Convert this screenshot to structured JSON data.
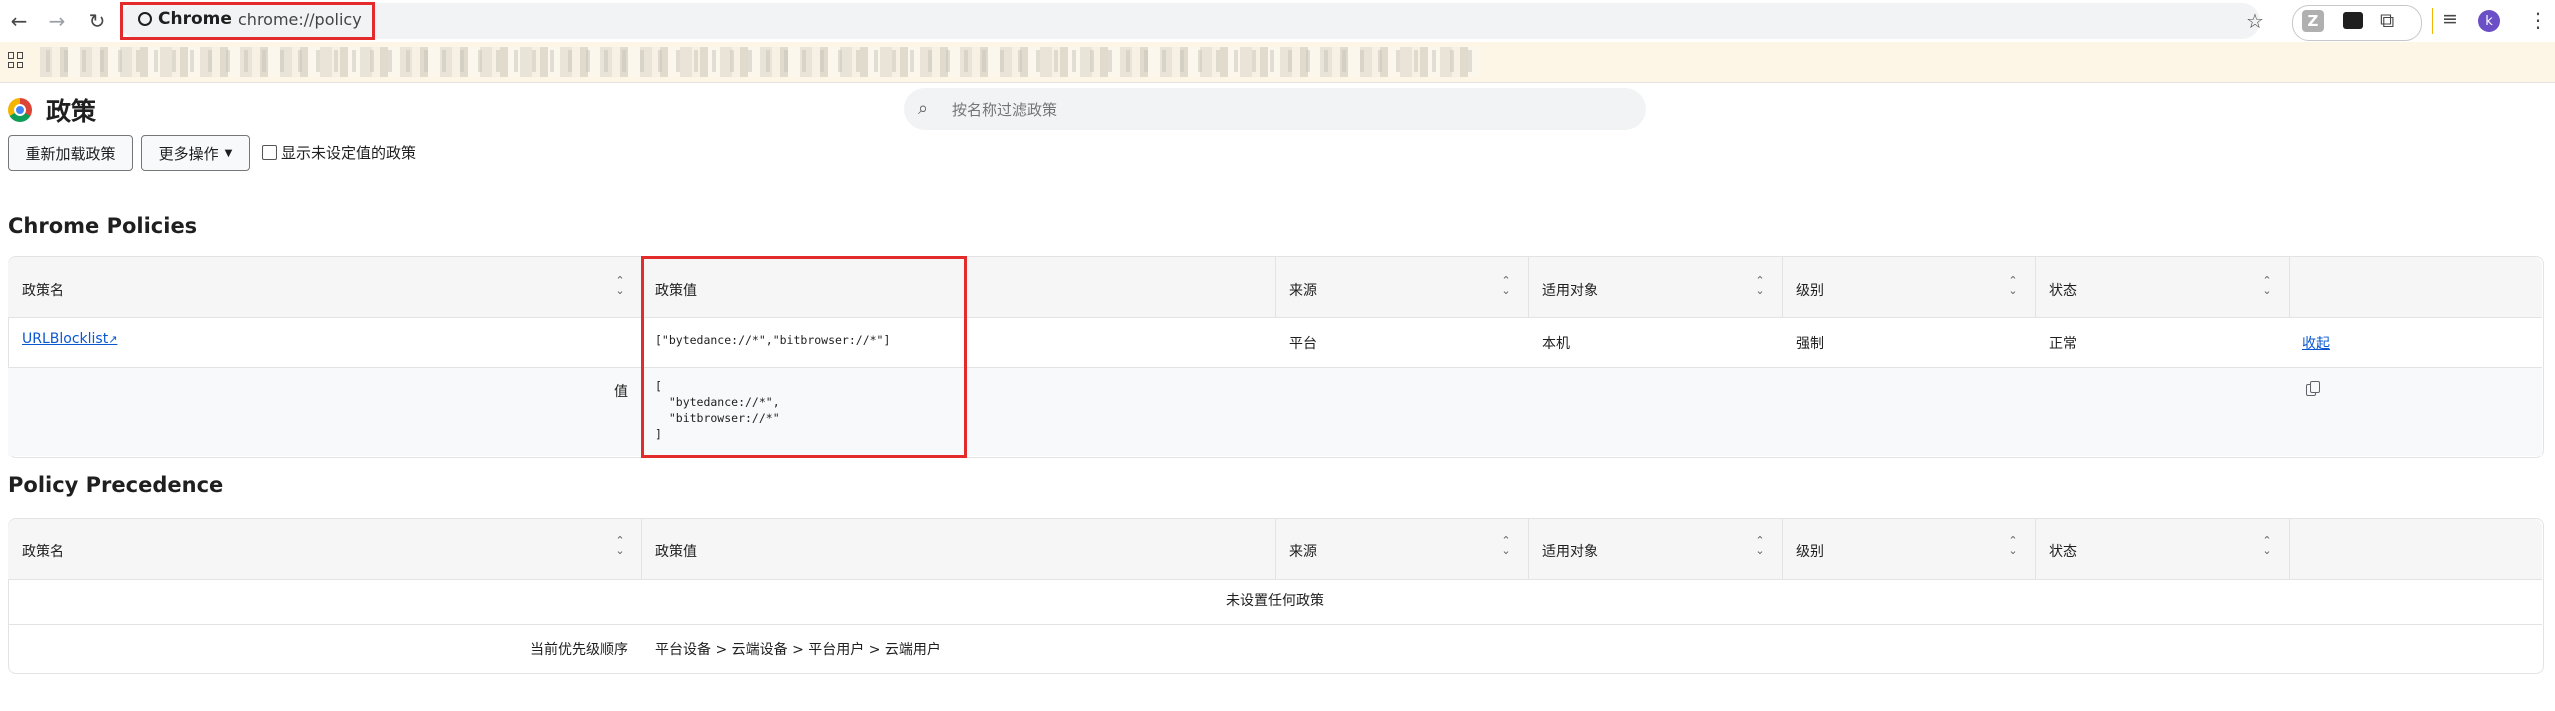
{
  "browser": {
    "site_chip": "Chrome",
    "url": "chrome://policy"
  },
  "page": {
    "title": "政策",
    "search_placeholder": "按名称过滤政策",
    "reload_button": "重新加载政策",
    "more_actions_button": "更多操作",
    "show_unset_label": "显示未设定值的政策",
    "avatar_letter": "k"
  },
  "columns": [
    "政策名",
    "政策值",
    "来源",
    "适用对象",
    "级别",
    "状态"
  ],
  "chrome_policies": {
    "title": "Chrome Policies",
    "rows": [
      {
        "name": "URLBlocklist",
        "value": "[\"bytedance://*\",\"bitbrowser://*\"]",
        "source": "平台",
        "scope": "本机",
        "level": "强制",
        "status": "正常",
        "action": "收起",
        "detail_label": "值",
        "detail_value": "[\n  \"bytedance://*\",\n  \"bitbrowser://*\"\n]"
      }
    ]
  },
  "policy_precedence": {
    "title": "Policy Precedence",
    "empty_message": "未设置任何政策",
    "order_label": "当前优先级顺序",
    "order_value": "平台设备 > 云端设备 > 平台用户 > 云端用户"
  },
  "colors": {
    "highlight": "#e32b2b",
    "link": "#0b57d0",
    "header_bg": "#f6f6f6",
    "bookmark_bar": "#fdf6e6"
  }
}
